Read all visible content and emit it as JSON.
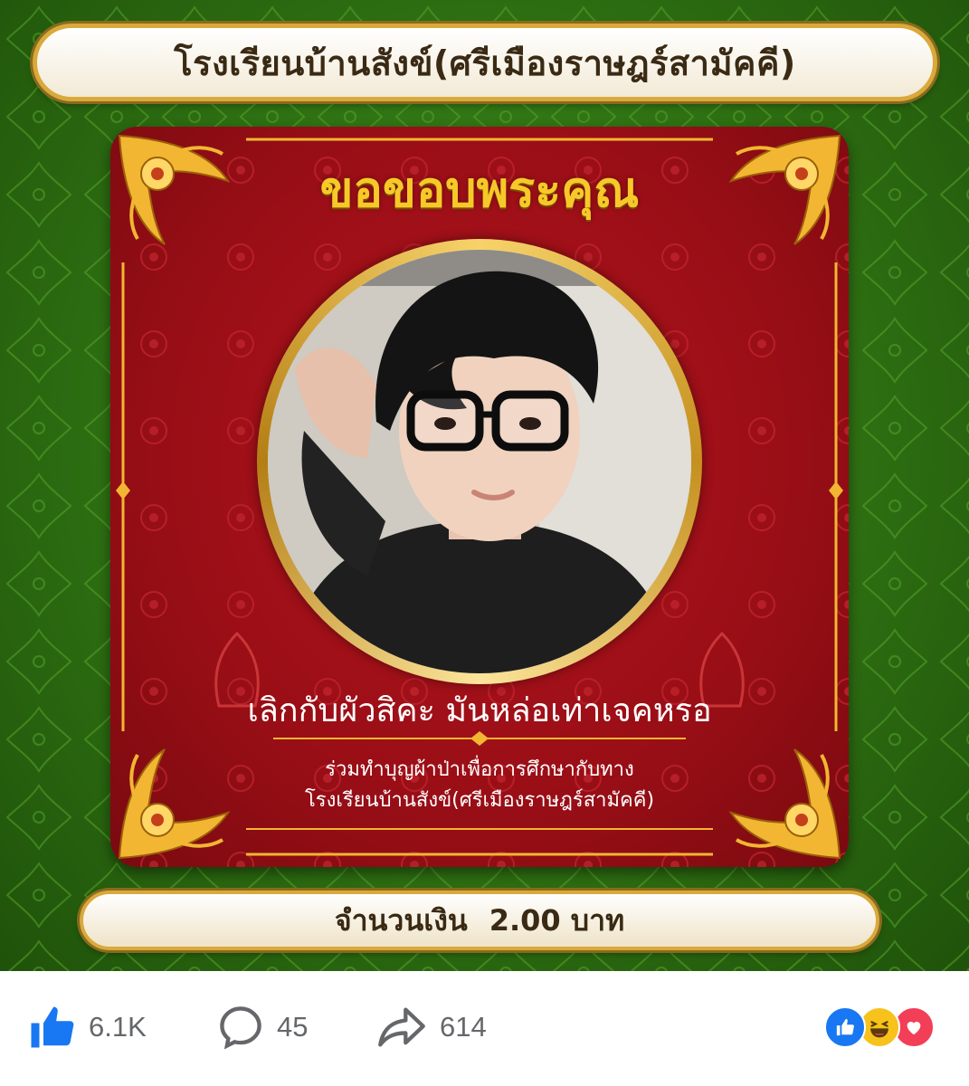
{
  "poster": {
    "school_name": "โรงเรียนบ้านสังข์(ศรีเมืองราษฎร์สามัคคี)",
    "title": "ขอขอบพระคุณ",
    "donor_name": "เลิกกับผัวสิคะ มันหล่อเท่าเจคหรอ",
    "caption_line1": "ร่วมทำบุญผ้าป่าเพื่อการศึกษากับทาง",
    "caption_line2": "โรงเรียนบ้านสังข์(ศรีเมืองราษฎร์สามัคคี)",
    "amount_label": "จำนวนเงิน",
    "amount_value": "2.00 บาท",
    "colors": {
      "background_green": "#2e6f12",
      "card_red": "#990e16",
      "gold": "#f7c928"
    }
  },
  "actions": {
    "like_count": "6.1K",
    "comment_count": "45",
    "share_count": "614"
  },
  "reactions": {
    "icons": [
      "like-icon",
      "haha-icon",
      "love-icon"
    ]
  }
}
